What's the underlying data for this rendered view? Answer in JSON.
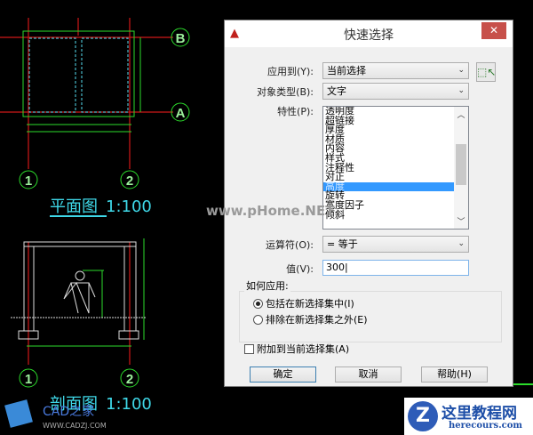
{
  "drawing": {
    "plan_title": "平面图",
    "plan_scale": "1:100",
    "section_title": "剖面图",
    "section_scale": "1:100",
    "axis_labels": [
      "B",
      "A",
      "1",
      "2"
    ],
    "watermark": "www.pHome.NET",
    "cad_logo": "CAD之家",
    "cad_url": "WWW.CADZJ.COM"
  },
  "dialog": {
    "title": "快速选择",
    "apply_to_label": "应用到(Y):",
    "apply_to_value": "当前选择",
    "object_type_label": "对象类型(B):",
    "object_type_value": "文字",
    "properties_label": "特性(P):",
    "properties": [
      "透明度",
      "超链接",
      "厚度",
      "材质",
      "内容",
      "样式",
      "注释性",
      "对正",
      "高度",
      "旋转",
      "宽度因子",
      "倾斜"
    ],
    "selected_property": "高度",
    "operator_label": "运算符(O):",
    "operator_value": "= 等于",
    "value_label": "值(V):",
    "value": "300",
    "how_to_apply_label": "如何应用:",
    "include_label": "包括在新选择集中(I)",
    "exclude_label": "排除在新选择集之外(E)",
    "append_label": "附加到当前选择集(A)",
    "ok": "确定",
    "cancel": "取消",
    "help": "帮助(H)"
  },
  "site_logo": {
    "name": "这里教程网",
    "url": "herecours.com"
  }
}
